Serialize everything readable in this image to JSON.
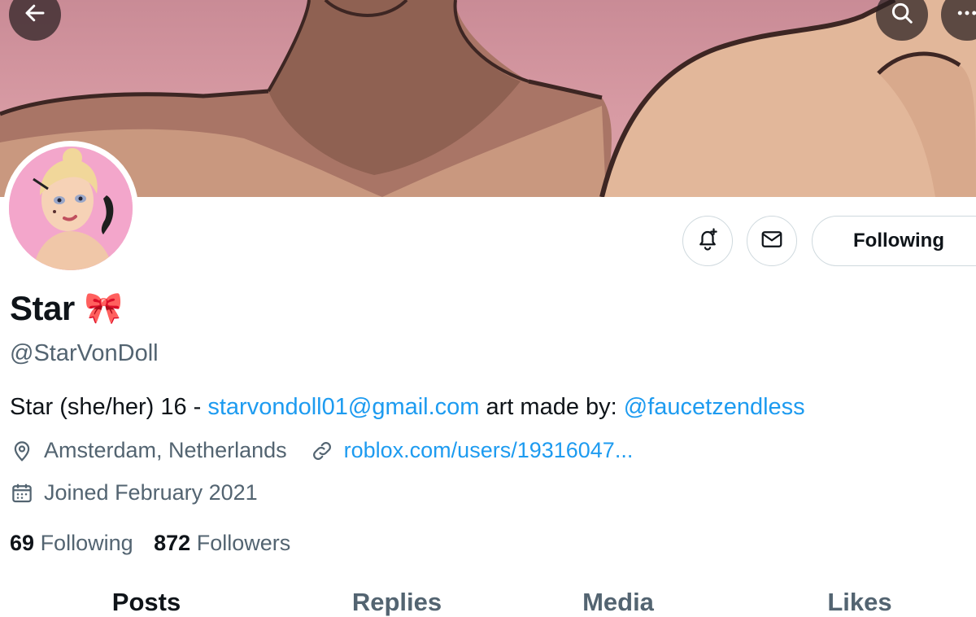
{
  "profile": {
    "name": "Star",
    "name_emoji": "🎀",
    "handle": "@StarVonDoll",
    "bio": {
      "text1": "Star (she/her) 16 - ",
      "email": "starvondoll01@gmail.com",
      "text2": " art made by: ",
      "mention": "@faucetzendless"
    },
    "location": "Amsterdam, Netherlands",
    "website": "roblox.com/users/19316047...",
    "joined": "Joined February 2021",
    "following_count": "69",
    "following_label": "Following",
    "followers_count": "872",
    "followers_label": "Followers"
  },
  "actions": {
    "following_button": "Following"
  },
  "tabs": [
    {
      "label": "Posts",
      "active": true
    },
    {
      "label": "Replies",
      "active": false
    },
    {
      "label": "Media",
      "active": false
    },
    {
      "label": "Likes",
      "active": false
    }
  ],
  "icons": {
    "back": "back-arrow-icon",
    "search": "search-icon",
    "more": "more-icon",
    "notify": "bell-plus-icon",
    "message": "envelope-icon",
    "location": "location-pin-icon",
    "link": "link-icon",
    "calendar": "calendar-icon"
  },
  "colors": {
    "link": "#1d9bf0",
    "secondary_text": "#536471",
    "primary_text": "#0f1419",
    "banner": "#d79aa3"
  }
}
